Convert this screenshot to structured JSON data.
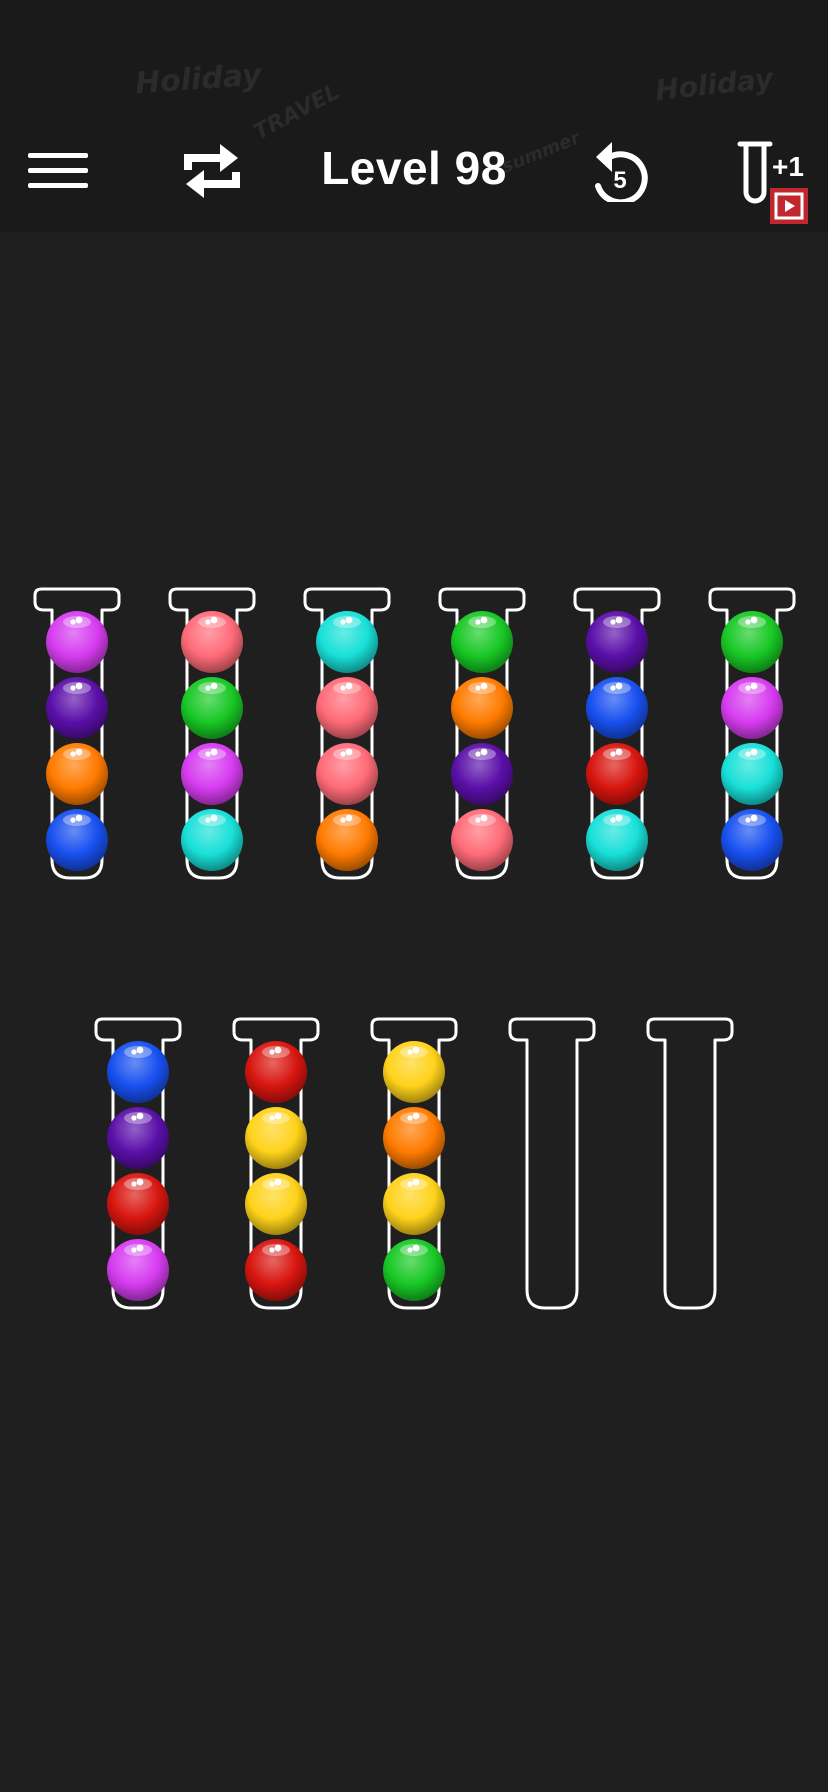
{
  "header": {
    "level_prefix": "Level",
    "level_number": "98",
    "undo_count": "5",
    "add_tube_label": "+1",
    "background_doodle_words": [
      "Holiday",
      "Holiday",
      "TRAVEL",
      "summer",
      "Holiday"
    ]
  },
  "icons": {
    "menu": "menu-icon",
    "restart": "restart-icon",
    "undo": "undo-icon",
    "add_tube": "add-tube-icon",
    "video_ad": "video-play-icon"
  },
  "colors": {
    "background": "#1f1f1f",
    "tube_outline": "#ffffff",
    "video_badge": "#c0262d",
    "ball_palette": {
      "magenta": "#d63cf0",
      "violet": "#5a0fa8",
      "orange": "#ff7b00",
      "blue": "#1850f0",
      "pink": "#ff6b78",
      "green": "#18c825",
      "cyan": "#18e0d8",
      "red": "#d8150f",
      "yellow": "#ffd21a"
    }
  },
  "board": {
    "balls_per_tube": 4,
    "rows": [
      {
        "tubes": [
          {
            "balls": [
              "magenta",
              "violet",
              "orange",
              "blue"
            ]
          },
          {
            "balls": [
              "pink",
              "green",
              "magenta",
              "cyan"
            ]
          },
          {
            "balls": [
              "cyan",
              "pink",
              "pink",
              "orange"
            ]
          },
          {
            "balls": [
              "green",
              "orange",
              "violet",
              "pink"
            ]
          },
          {
            "balls": [
              "violet",
              "blue",
              "red",
              "cyan"
            ]
          },
          {
            "balls": [
              "green",
              "magenta",
              "cyan",
              "blue"
            ]
          }
        ]
      },
      {
        "tubes": [
          {
            "balls": [
              "blue",
              "violet",
              "red",
              "magenta"
            ]
          },
          {
            "balls": [
              "red",
              "yellow",
              "yellow",
              "red"
            ]
          },
          {
            "balls": [
              "yellow",
              "orange",
              "yellow",
              "green"
            ]
          },
          {
            "balls": []
          },
          {
            "balls": []
          }
        ]
      }
    ]
  }
}
